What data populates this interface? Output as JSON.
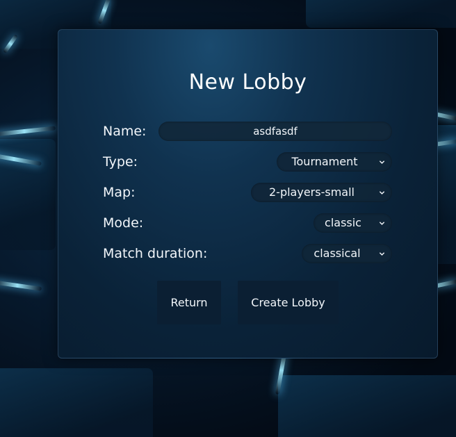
{
  "dialog": {
    "title": "New Lobby"
  },
  "form": {
    "name": {
      "label": "Name:",
      "value": "asdfasdf"
    },
    "type": {
      "label": "Type:",
      "selected": "Tournament"
    },
    "map": {
      "label": "Map:",
      "selected": "2-players-small"
    },
    "mode": {
      "label": "Mode:",
      "selected": "classic"
    },
    "duration": {
      "label": "Match duration:",
      "selected": "classical"
    }
  },
  "actions": {
    "return_label": "Return",
    "create_label": "Create Lobby"
  },
  "icons": {
    "dropdown": "chevron-down-icon"
  },
  "colors": {
    "text": "#f2f6fa",
    "panel": "#10324f",
    "button": "#0b1f33",
    "glow": "#a0ebff"
  }
}
